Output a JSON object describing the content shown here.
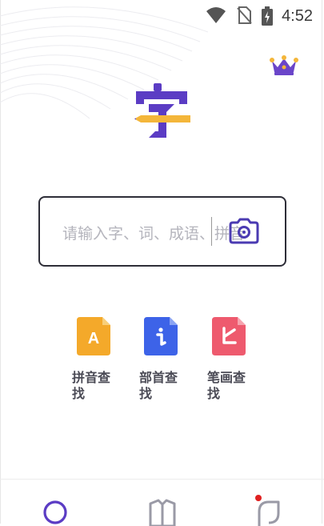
{
  "status": {
    "time": "4:52"
  },
  "search": {
    "placeholder": "请输入字、词、成语、拼音"
  },
  "finders": [
    {
      "label": "拼音查找",
      "glyph": "A",
      "color": "#f4a92a"
    },
    {
      "label": "部首查找",
      "glyph": "i",
      "color": "#3d63e8"
    },
    {
      "label": "笔画查找",
      "glyph": "匕",
      "color": "#ee5a6e"
    }
  ],
  "colors": {
    "brand": "#5b3cc4",
    "accent": "#f4b63a",
    "nav_dot": "#e02020"
  },
  "icons": {
    "crown": "crown-icon",
    "camera": "camera-icon",
    "tabs": [
      "home-circle-icon",
      "book-icon",
      "leaf-icon"
    ]
  }
}
